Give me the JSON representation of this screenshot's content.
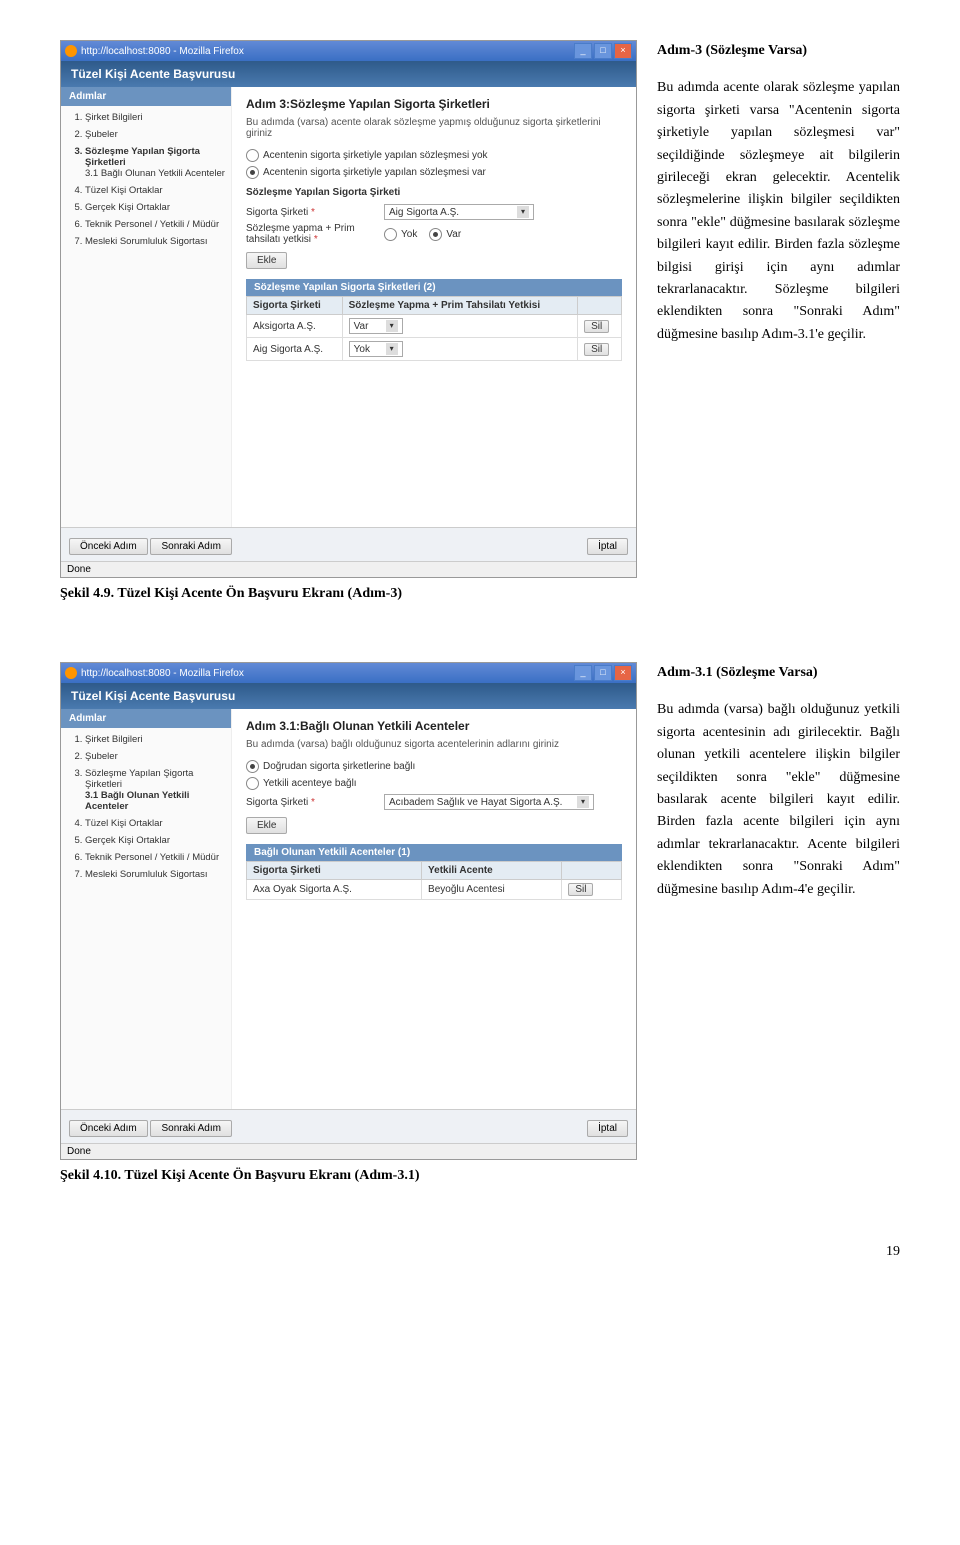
{
  "sectionA": {
    "heading": "Adım-3 (Sözleşme Varsa)",
    "paragraph": "Bu adımda acente olarak sözleşme yapılan sigorta şirketi varsa \"Acentenin sigorta şirketiyle yapılan sözleşmesi var\" seçildiğinde sözleşmeye ait bilgilerin girileceği ekran gelecektir. Acentelik sözleşmelerine ilişkin bilgiler seçildikten sonra \"ekle\" düğmesine basılarak sözleşme bilgileri kayıt edilir. Birden fazla sözleşme bilgisi girişi için aynı adımlar tekrarlanacaktır. Sözleşme bilgileri eklendikten sonra \"Sonraki Adım\" düğmesine basılıp Adım-3.1'e geçilir.",
    "caption": "Şekil 4.9. Tüzel Kişi Acente Ön Başvuru Ekranı (Adım-3)"
  },
  "sectionB": {
    "heading": "Adım-3.1 (Sözleşme Varsa)",
    "paragraph": "Bu adımda (varsa) bağlı olduğunuz yetkili sigorta acentesinin adı girilecektir. Bağlı olunan yetkili acentelere ilişkin bilgiler seçildikten sonra \"ekle\" düğmesine basılarak acente bilgileri kayıt edilir. Birden fazla acente bilgileri için aynı adımlar tekrarlanacaktır. Acente bilgileri eklendikten sonra \"Sonraki Adım\" düğmesine basılıp Adım-4'e geçilir.",
    "caption": "Şekil 4.10. Tüzel Kişi Acente Ön Başvuru Ekranı (Adım-3.1)"
  },
  "browser": {
    "title": "http://localhost:8080 - Mozilla Firefox",
    "pageTitle": "Tüzel Kişi Acente Başvurusu",
    "status": "Done"
  },
  "sidebar": {
    "head": "Adımlar",
    "items": [
      "Şirket Bilgileri",
      "Şubeler",
      "Sözleşme Yapılan Şigorta Şirketleri",
      "Tüzel Kişi Ortaklar",
      "Gerçek Kişi Ortaklar",
      "Teknik Personel / Yetkili / Müdür",
      "Mesleki Sorumluluk Sigortası"
    ],
    "sub31": "3.1 Bağlı Olunan Yetkili Acenteler"
  },
  "screenA": {
    "h3": "Adım 3:Sözleşme Yapılan Sigorta Şirketleri",
    "desc": "Bu adımda (varsa) acente olarak sözleşme yapmış olduğunuz sigorta şirketlerini giriniz",
    "radio1": "Acentenin sigorta şirketiyle yapılan sözleşmesi yok",
    "radio2": "Acentenin sigorta şirketiyle yapılan sözleşmesi var",
    "sub": "Sözleşme Yapılan Sigorta Şirketi",
    "lbl_company": "Sigorta Şirketi",
    "company_value": "Aig Sigorta A.Ş.",
    "lbl_yetki": "Sözleşme yapma + Prim tahsilatı yetkisi",
    "opt_yok": "Yok",
    "opt_var": "Var",
    "btn_ekle": "Ekle",
    "tableHead": "Sözleşme Yapılan Sigorta Şirketleri (2)",
    "th1": "Sigorta Şirketi",
    "th2": "Sözleşme Yapma + Prim Tahsilatı Yetkisi",
    "r1c1": "Aksigorta A.Ş.",
    "r1c2": "Var",
    "r2c1": "Aig Sigorta A.Ş.",
    "r2c2": "Yok",
    "btn_sil": "Sil"
  },
  "screenB": {
    "h3": "Adım 3.1:Bağlı Olunan Yetkili Acenteler",
    "desc": "Bu adımda (varsa) bağlı olduğunuz sigorta acentelerinin adlarını giriniz",
    "radio1": "Doğrudan sigorta şirketlerine bağlı",
    "radio2": "Yetkili acenteye bağlı",
    "lbl_company": "Sigorta Şirketi",
    "company_value": "Acıbadem Sağlık ve Hayat Sigorta A.Ş.",
    "btn_ekle": "Ekle",
    "tableHead": "Bağlı Olunan Yetkili Acenteler (1)",
    "th1": "Sigorta Şirketi",
    "th2": "Yetkili Acente",
    "r1c1": "Axa Oyak Sigorta A.Ş.",
    "r1c2": "Beyoğlu Acentesi",
    "btn_sil": "Sil"
  },
  "footer": {
    "prev": "Önceki Adım",
    "next": "Sonraki Adım",
    "cancel": "İptal"
  },
  "pageNumber": "19"
}
